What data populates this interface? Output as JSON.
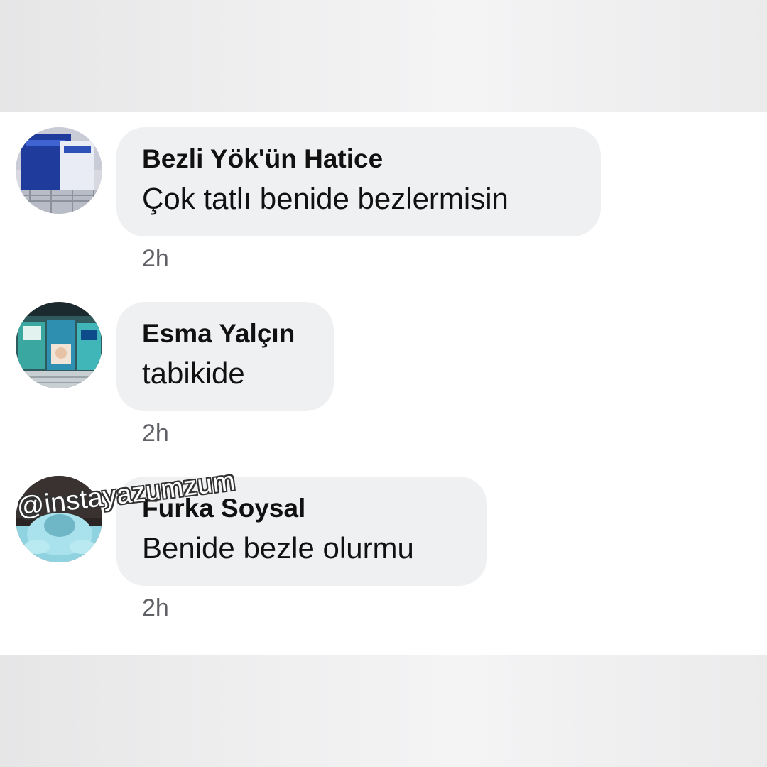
{
  "comments": [
    {
      "author": "Bezli Yök'ün Hatice",
      "text": "Çok tatlı benide bezlermisin",
      "time": "2h",
      "avatar_icon": "diaper-pack-photo-icon"
    },
    {
      "author": "Esma Yalçın",
      "text": "tabikide",
      "time": "2h",
      "avatar_icon": "diaper-shelf-photo-icon"
    },
    {
      "author": "Furka Soysal",
      "text": "Benide bezle olurmu",
      "time": "2h",
      "avatar_icon": "diaper-photo-icon"
    }
  ],
  "watermark": "@instayazumzum",
  "colors": {
    "bubble": "#eff0f2",
    "text": "#111111",
    "time": "#5f6166",
    "panel": "#ffffff"
  }
}
